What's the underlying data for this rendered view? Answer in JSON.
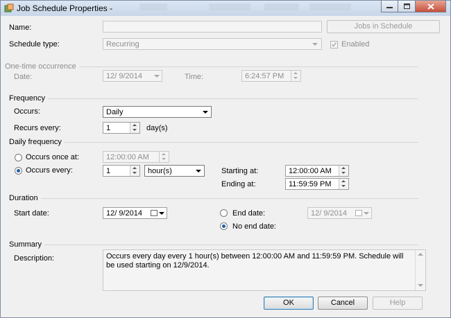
{
  "window": {
    "title": "Job Schedule Properties -"
  },
  "name": {
    "label": "Name:",
    "value": ""
  },
  "jobs_in_schedule_label": "Jobs in Schedule",
  "schedule_type": {
    "label": "Schedule type:",
    "value": "Recurring",
    "enabled_label": "Enabled",
    "enabled_checked": true
  },
  "one_time": {
    "section": "One-time occurrence",
    "date_label": "Date:",
    "date_value": "12/ 9/2014",
    "time_label": "Time:",
    "time_value": "6:24:57 PM"
  },
  "frequency": {
    "section": "Frequency",
    "occurs_label": "Occurs:",
    "occurs_value": "Daily",
    "recurs_label": "Recurs every:",
    "recurs_value": "1",
    "recurs_unit": "day(s)"
  },
  "daily_frequency": {
    "section": "Daily frequency",
    "once_label": "Occurs once at:",
    "once_value": "12:00:00 AM",
    "every_label": "Occurs every:",
    "every_value": "1",
    "every_unit": "hour(s)",
    "starting_label": "Starting at:",
    "starting_value": "12:00:00 AM",
    "ending_label": "Ending at:",
    "ending_value": "11:59:59 PM",
    "selected": "every"
  },
  "duration": {
    "section": "Duration",
    "start_label": "Start date:",
    "start_value": "12/ 9/2014",
    "end_label": "End date:",
    "end_value": "12/ 9/2014",
    "no_end_label": "No end date:",
    "selected": "no_end"
  },
  "summary": {
    "section": "Summary",
    "description_label": "Description:",
    "description": "Occurs every day every 1 hour(s) between 12:00:00 AM and 11:59:59 PM. Schedule will be used starting on 12/9/2014."
  },
  "buttons": {
    "ok": "OK",
    "cancel": "Cancel",
    "help": "Help"
  },
  "colors": {
    "title_bar": "#c7d6e9",
    "close_button": "#c7503a",
    "dialog_bg": "#f0f0f0",
    "focus_border": "#3c7fb1"
  }
}
